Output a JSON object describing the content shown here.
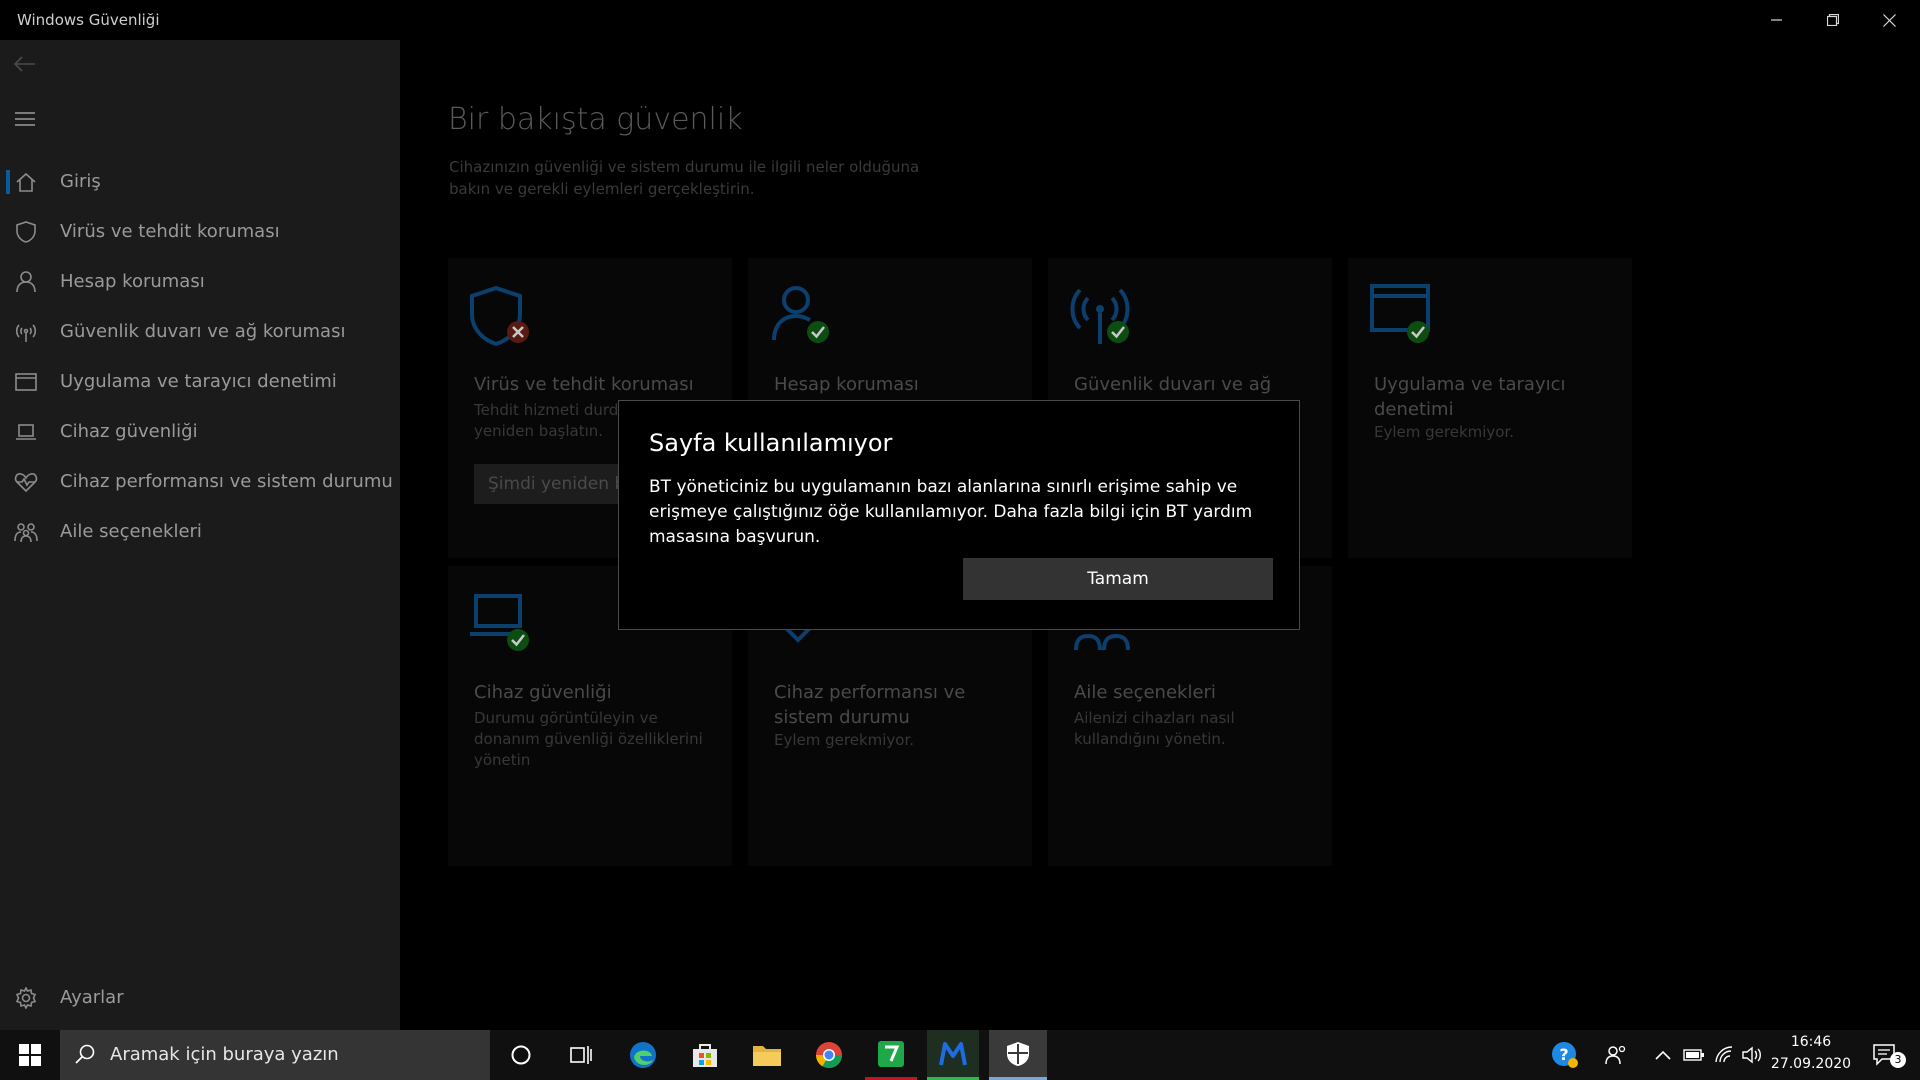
{
  "window": {
    "title": "Windows Güvenliği",
    "controls": [
      "minimize-icon",
      "restore-icon",
      "close-icon"
    ]
  },
  "sidebar": {
    "back_icon": "back-arrow-icon",
    "menu_icon": "hamburger-icon",
    "items": [
      {
        "label": "Giriş",
        "icon": "home-icon",
        "active": true
      },
      {
        "label": "Virüs ve tehdit koruması",
        "icon": "shield-icon"
      },
      {
        "label": "Hesap koruması",
        "icon": "person-icon"
      },
      {
        "label": "Güvenlik duvarı ve ağ koruması",
        "icon": "antenna-icon"
      },
      {
        "label": "Uygulama ve tarayıcı denetimi",
        "icon": "browser-window-icon"
      },
      {
        "label": "Cihaz güvenliği",
        "icon": "laptop-icon"
      },
      {
        "label": "Cihaz performansı ve sistem durumu",
        "icon": "heart-icon"
      },
      {
        "label": "Aile seçenekleri",
        "icon": "family-icon"
      }
    ],
    "settings": {
      "label": "Ayarlar",
      "icon": "gear-icon"
    }
  },
  "main": {
    "title": "Bir bakışta güvenlik",
    "description": "Cihazınızın güvenliği ve sistem durumu ile ilgili neler olduğuna bakın ve gerekli eylemleri gerçekleştirin.",
    "tiles": [
      {
        "title": "Virüs ve tehdit koruması",
        "desc": "Tehdit hizmeti durdu. Hemen yeniden başlatın.",
        "button": "Şimdi yeniden başlat",
        "status": "error"
      },
      {
        "title": "Hesap koruması",
        "desc": "",
        "status": "ok"
      },
      {
        "title": "Güvenlik duvarı ve ağ koruması",
        "desc": "",
        "status": "ok"
      },
      {
        "title": "Uygulama ve tarayıcı denetimi",
        "desc": "Eylem gerekmiyor.",
        "status": "ok"
      },
      {
        "title": "Cihaz güvenliği",
        "desc": "Durumu görüntüleyin ve donanım güvenliği özelliklerini yönetin",
        "status": "ok"
      },
      {
        "title": "Cihaz performansı ve sistem durumu",
        "desc": "Eylem gerekmiyor.",
        "status": "ok"
      },
      {
        "title": "Aile seçenekleri",
        "desc": "Ailenizi cihazları nasıl kullandığını yönetin.",
        "status": "none"
      }
    ]
  },
  "dialog": {
    "title": "Sayfa kullanılamıyor",
    "message": "BT yöneticiniz bu uygulamanın bazı alanlarına sınırlı erişime sahip ve erişmeye çalıştığınız öğe kullanılamıyor. Daha fazla bilgi için BT yardım masasına başvurun.",
    "ok_label": "Tamam"
  },
  "taskbar": {
    "search_placeholder": "Aramak için buraya yazın",
    "apps": [
      "cortana-icon",
      "task-view-icon",
      "edge-icon",
      "store-icon",
      "file-explorer-icon",
      "chrome-icon",
      "app-green-icon",
      "malwarebytes-icon",
      "windows-security-icon"
    ],
    "time": "16:46",
    "date": "27.09.2020",
    "notification_count": "3"
  },
  "colors": {
    "accent": "#0a5a9e",
    "ok_green": "#107c10",
    "error_red": "#c42b1c"
  }
}
